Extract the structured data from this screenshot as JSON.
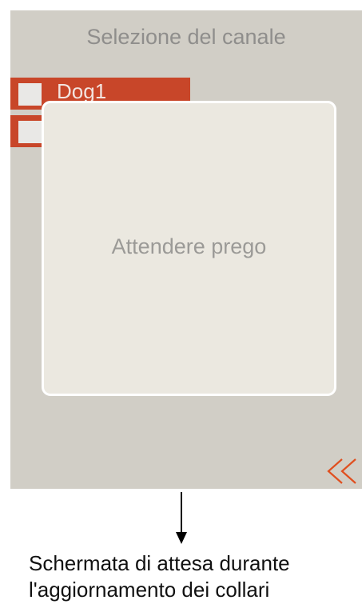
{
  "screen": {
    "title": "Selezione del canale",
    "channels": [
      {
        "label": "Dog1",
        "checked": false
      },
      {
        "label": "",
        "checked": false
      }
    ],
    "dialog": {
      "message": "Attendere prego"
    },
    "back_button": {
      "icon": "double-chevron-left-icon",
      "color": "#e04f1f"
    }
  },
  "caption": {
    "line1": "Schermata di attesa durante",
    "line2": "l'aggiornamento dei collari"
  },
  "colors": {
    "screen_background": "#d1cec6",
    "channel_item": "#c84629",
    "dialog_background": "#ebe8e0",
    "accent": "#e04f1f"
  }
}
